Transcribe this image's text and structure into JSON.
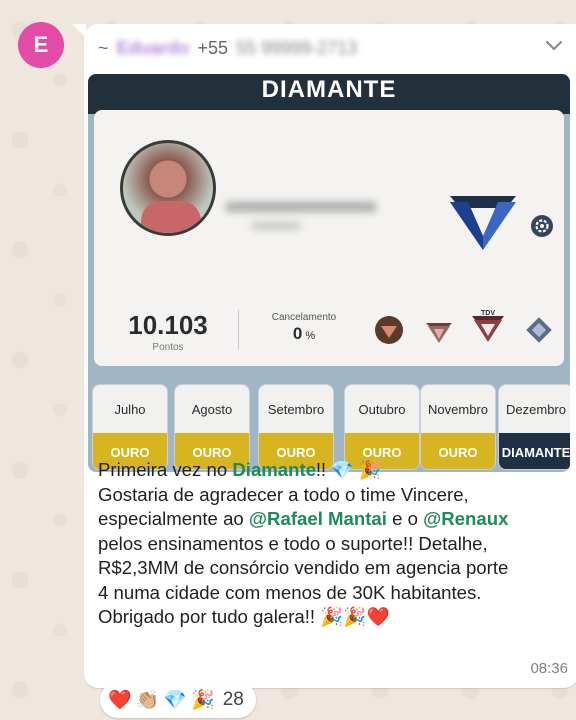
{
  "sender": {
    "avatar_letter": "E",
    "tilde": "~",
    "name": "Eduardo",
    "phone_prefix": "+55",
    "phone_rest": "55 99999-2713"
  },
  "card": {
    "title": "DIAMANTE",
    "points_value": "10.103",
    "points_label": "Pontos",
    "cancel_label": "Cancelamento",
    "cancel_value": "0",
    "cancel_unit": "%",
    "badge_tdv": "TDV"
  },
  "months": [
    {
      "name": "Julho",
      "level": "OURO"
    },
    {
      "name": "Agosto",
      "level": "OURO"
    },
    {
      "name": "Setembro",
      "level": "OURO"
    },
    {
      "name": "Outubro",
      "level": "OURO"
    },
    {
      "name": "Novembro",
      "level": "OURO"
    },
    {
      "name": "Dezembro",
      "level": "DIAMANTE"
    }
  ],
  "message": {
    "l1_a": "Primeira vez no ",
    "l1_mention": "Diamante",
    "l1_b": "!! 💎 🎉",
    "l2": "Gostaria de agradecer a todo o time Vincere,",
    "l3_a": "especialmente ao ",
    "l3_mention1": "@Rafael Mantai",
    "l3_b": " e o ",
    "l3_mention2": "@Renaux",
    "l4": "pelos ensinamentos e todo o suporte!! Detalhe,",
    "l5": "R$2,3MM de consórcio vendido em agencia porte",
    "l6": "4 numa cidade com menos de 30K habitantes.",
    "l7": "Obrigado por tudo galera!! 🎉🎉❤️",
    "time": "08:36"
  },
  "reactions": {
    "emojis": [
      "❤️",
      "👏🏼",
      "💎",
      "🎉"
    ],
    "count": "28"
  },
  "colors": {
    "avatar_bg": "#e24ca8",
    "mention": "#1f8a5b",
    "gold": "#d7b520",
    "diamond_dark": "#1f2f45"
  }
}
